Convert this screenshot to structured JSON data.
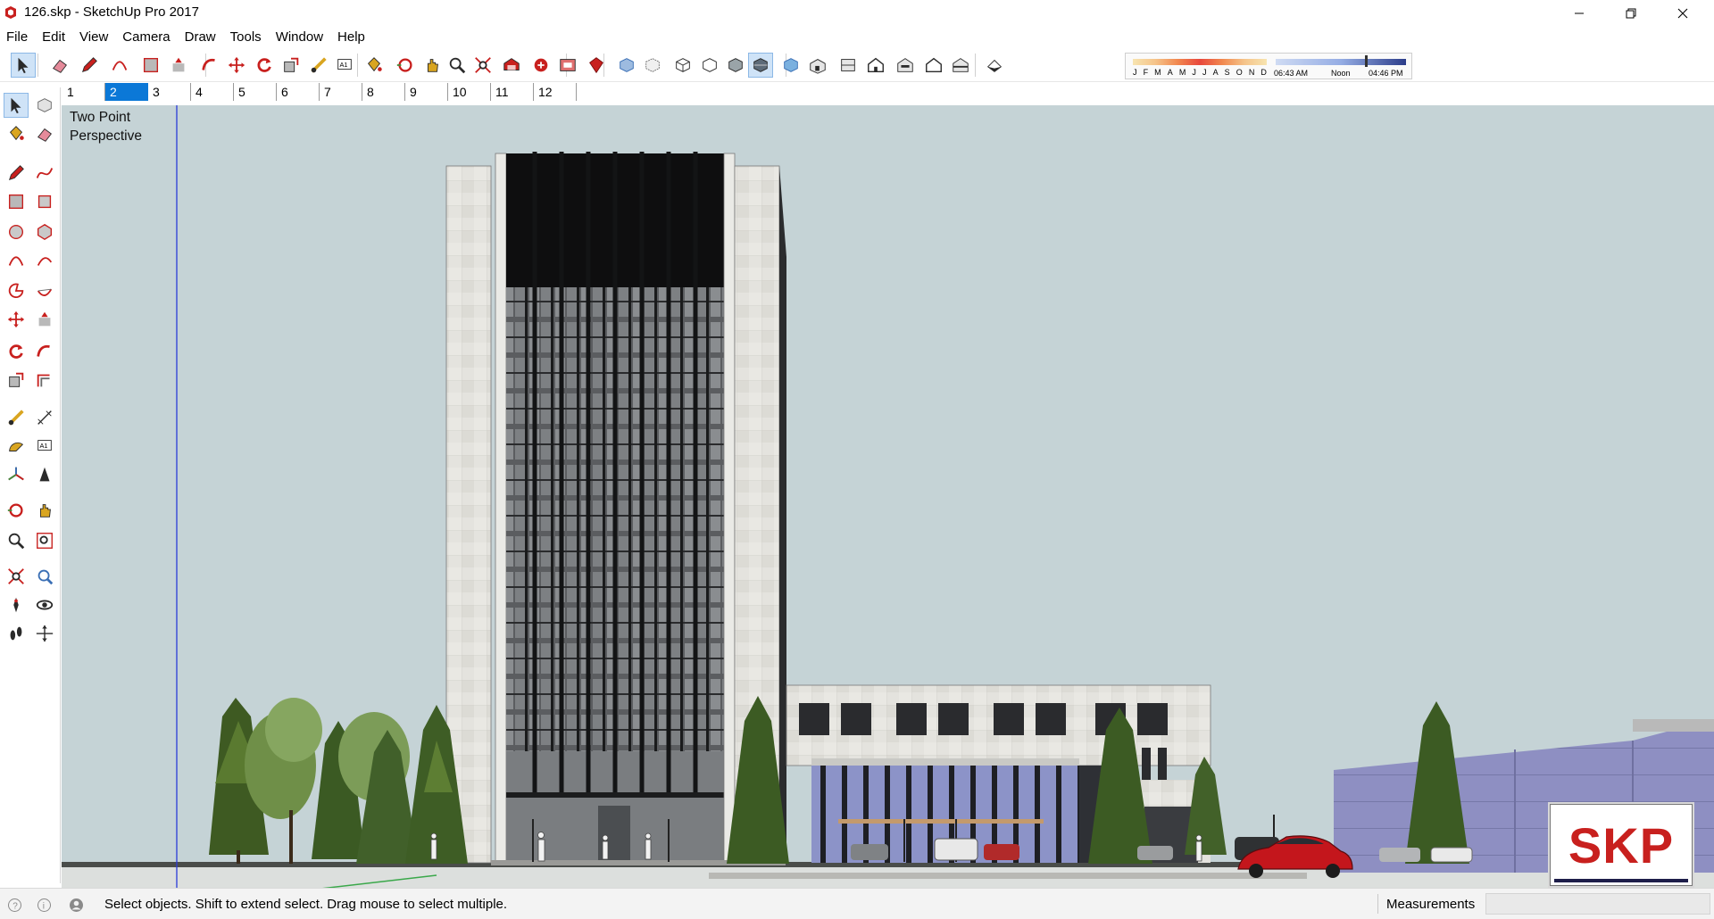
{
  "window": {
    "title": "126.skp - SketchUp Pro 2017"
  },
  "menu": [
    "File",
    "Edit",
    "View",
    "Camera",
    "Draw",
    "Tools",
    "Window",
    "Help"
  ],
  "toolbar": {
    "icons": [
      "select-icon",
      "eraser-icon",
      "pencil-icon",
      "arc-icon",
      "rectangle-icon",
      "push-pull-icon",
      "follow-me-icon",
      "move-icon",
      "rotate-icon",
      "scale-icon",
      "tape-measure-icon",
      "text-icon",
      "paint-bucket-icon",
      "orbit-icon",
      "pan-icon",
      "zoom-icon",
      "zoom-extents-icon",
      "warehouse-icon",
      "share-model-icon",
      "extension-warehouse-icon",
      "ruby-icon",
      "xray-icon",
      "back-edges-icon",
      "wireframe-icon",
      "hidden-line-icon",
      "shaded-icon",
      "shaded-textures-icon",
      "monochrome-icon",
      "iso-view-icon",
      "top-view-icon",
      "front-view-icon",
      "right-view-icon",
      "back-view-icon",
      "left-view-icon",
      "shadows-toggle-icon"
    ]
  },
  "shadow_settings": {
    "months": [
      "J",
      "F",
      "M",
      "A",
      "M",
      "J",
      "J",
      "A",
      "S",
      "O",
      "N",
      "D"
    ],
    "time_start": "06:43 AM",
    "time_mid": "Noon",
    "time_end": "04:46 PM"
  },
  "scenes": {
    "tabs": [
      "1",
      "2",
      "3",
      "4",
      "5",
      "6",
      "7",
      "8",
      "9",
      "10",
      "11",
      "12"
    ],
    "active": "2"
  },
  "lefttools": [
    "select-icon",
    "component-icon",
    "paint-bucket-icon",
    "eraser-icon",
    "line-icon",
    "freehand-icon",
    "rectangle-icon",
    "rotated-rectangle-icon",
    "circle-icon",
    "polygon-icon",
    "arc-icon",
    "arc-2pt-icon",
    "pie-icon",
    "arc-3pt-icon",
    "move-icon",
    "push-pull-icon",
    "rotate-icon",
    "follow-me-icon",
    "scale-icon",
    "offset-icon",
    "tape-measure-icon",
    "dimension-icon",
    "protractor-icon",
    "text-icon",
    "axes-icon",
    "3d-text-icon",
    "orbit-icon",
    "pan-icon",
    "zoom-icon",
    "zoom-window-icon",
    "zoom-extents-icon",
    "previous-view-icon",
    "position-camera-icon",
    "look-around-icon",
    "walk-icon",
    "section-plane-icon"
  ],
  "viewport": {
    "scene_label": "Two Point\nPerspective",
    "watermark": "SKP",
    "colors": {
      "sky": "#c5d3d6",
      "ground": "#4a4d4a",
      "accent_red": "#c8201e"
    }
  },
  "status": {
    "message": "Select objects. Shift to extend select. Drag mouse to select multiple.",
    "measurements_label": "Measurements",
    "measurements_value": ""
  }
}
